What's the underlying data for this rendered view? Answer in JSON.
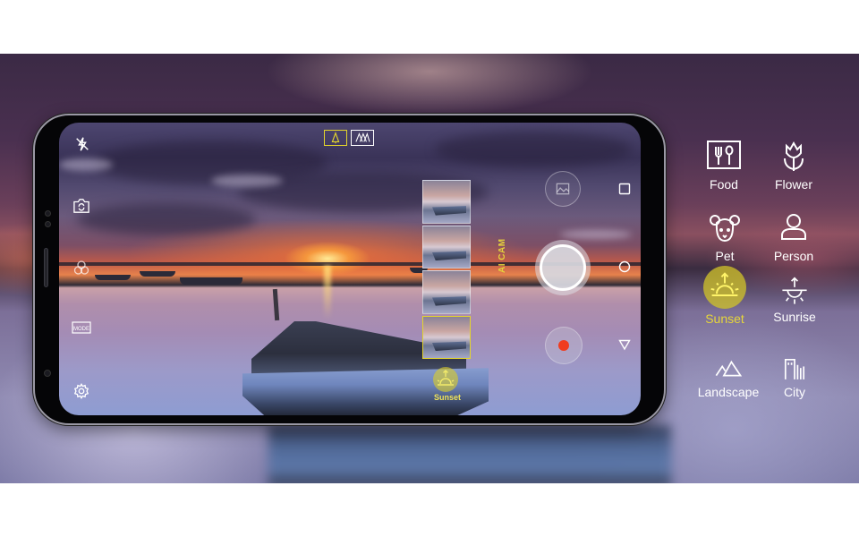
{
  "colors": {
    "accent_yellow": "#e6d63a",
    "record_red": "#f03c1e",
    "icon_white": "#ffffff"
  },
  "camera": {
    "left_controls": [
      {
        "name": "flash-off",
        "label": "Flash off"
      },
      {
        "name": "switch-camera",
        "label": "Switch camera"
      },
      {
        "name": "filter",
        "label": "Filter"
      },
      {
        "name": "mode",
        "label": "Mode"
      },
      {
        "name": "settings",
        "label": "Settings"
      }
    ],
    "top_modes": [
      {
        "name": "standard-lens",
        "active": true
      },
      {
        "name": "wide-lens",
        "active": false
      }
    ],
    "ai_cam_label": "AI CAM",
    "detected_scene_label": "Sunset",
    "thumbnail_count": 4,
    "nav_buttons": [
      "recents",
      "home",
      "back"
    ]
  },
  "scenes": [
    {
      "id": "food",
      "label": "Food",
      "icon": "food-icon",
      "active": false
    },
    {
      "id": "flower",
      "label": "Flower",
      "icon": "flower-icon",
      "active": false
    },
    {
      "id": "pet",
      "label": "Pet",
      "icon": "pet-icon",
      "active": false
    },
    {
      "id": "person",
      "label": "Person",
      "icon": "person-icon",
      "active": false
    },
    {
      "id": "sunset",
      "label": "Sunset",
      "icon": "sunset-icon",
      "active": true
    },
    {
      "id": "sunrise",
      "label": "Sunrise",
      "icon": "sunrise-icon",
      "active": false
    },
    {
      "id": "landscape",
      "label": "Landscape",
      "icon": "landscape-icon",
      "active": false
    },
    {
      "id": "city",
      "label": "City",
      "icon": "city-icon",
      "active": false
    }
  ]
}
